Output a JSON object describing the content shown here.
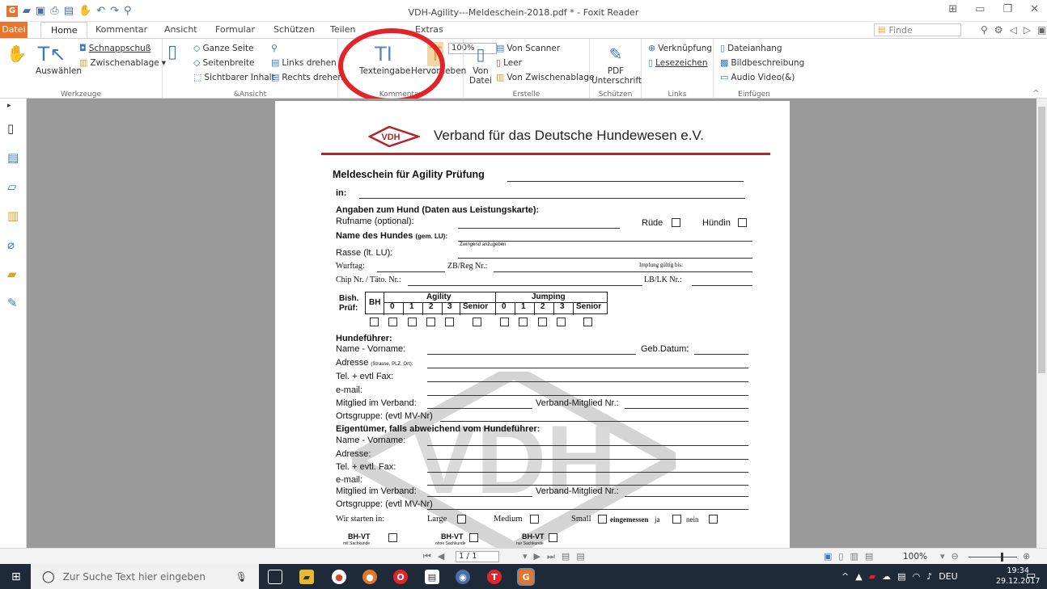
{
  "window": {
    "title": "VDH-Agility---Meldeschein-2018.pdf * - Foxit Reader",
    "app_logo": "G"
  },
  "menubar": {
    "tabs": [
      "Datei",
      "Home",
      "Kommentar",
      "Ansicht",
      "Formular",
      "Schützen",
      "Teilen",
      "Extras"
    ],
    "search_placeholder": "Finde"
  },
  "ribbon": {
    "werkzeuge": {
      "label": "Werkzeuge",
      "auswaehlen": "Auswählen",
      "schnappschuss": "Schnappschuß",
      "zwischenablage": "Zwischenablage"
    },
    "ansicht": {
      "label": "&Ansicht",
      "ganze_seite": "Ganze Seite",
      "seitenbreite": "Seitenbreite",
      "sichtbarer_inhalt": "Sichtbarer Inhalt",
      "zoom": "100%",
      "links_drehen": "Links drehen",
      "rechts_drehen": "Rechts drehen"
    },
    "kommentar": {
      "label": "Kommentar",
      "texteingabe": "Texteingabe",
      "hervorheben": "Hervorheben"
    },
    "erstelle": {
      "label": "Erstelle",
      "von_datei_1": "Von",
      "von_datei_2": "Datei",
      "von_scanner": "Von Scanner",
      "leer": "Leer",
      "von_zwischenablage": "Von Zwischenablage"
    },
    "schuetzen": {
      "label": "Schützen",
      "pdf": "PDF",
      "unterschrift": "Unterschrift"
    },
    "links": {
      "label": "Links",
      "verknuepfung": "Verknüpfung",
      "lesezeichen": "Lesezeichen"
    },
    "einfuegen": {
      "label": "Einfügen",
      "dateianhang": "Dateianhang",
      "bildbeschreibung": "Bildbeschreibung",
      "audio_video": "Audio Video(&)"
    }
  },
  "document": {
    "org_name": "Verband für das Deutsche Hundewesen e.V.",
    "logo_text": "VDH",
    "watermark_text": "VDH",
    "heading": "Meldeschein für Agility Prüfung",
    "in": "in:",
    "dog_section": "Angaben zum Hund (Daten aus Leistungskarte):",
    "rufname": "Rufname (optional):",
    "ruede": "Rüde",
    "huendin": "Hündin",
    "name_hund": "Name des Hundes",
    "gem_lu": "(gem. LU):",
    "zwingend": "Zwingend anzugeben",
    "rasse": "Rasse (lt. LU):",
    "wurftag": "Wurftag:",
    "zbreg": "ZB/Reg Nr.:",
    "impfung": "Impfung gültig bis:",
    "chip": "Chip Nr. / Täto. Nr.:",
    "lblk": "LB/LK Nr.:",
    "bish": "Bish.",
    "pruef": "Prüf:",
    "bh": "BH",
    "agility": "Agility",
    "jumping": "Jumping",
    "classes": [
      "0",
      "1",
      "2",
      "3",
      "Senior"
    ],
    "hundefuehrer": "Hundeführer:",
    "name_vorname": "Name - Vorname:",
    "geb_datum": "Geb.Datum:",
    "adresse": "Adresse",
    "adresse_small": "(Strasse, PLZ, Ort):",
    "tel_fax": "Tel. + evtl Fax:",
    "email": "e-mail:",
    "mitglied": "Mitglied im Verband:",
    "verband_mitglied": "Verband-Mitglied Nr.:",
    "ortsgruppe": "Ortsgruppe: (evtl MV-Nr)",
    "eigentuemer": "Eigentümer, falls abweichend vom Hundeführer:",
    "adresse2": "Adresse:",
    "tel_fax2": "Tel. + evtl. Fax:",
    "wir_starten": "Wir starten in:",
    "large": "Large",
    "medium": "Medium",
    "small": "Small",
    "eingemessen": "eingemessen",
    "ja": "ja",
    "nein": "nein",
    "bhvt": "BH-VT",
    "mit_sachkunde": "mit Sachkunde",
    "ohne_sachkunde": "ohne Sachkunde",
    "nur_sachkunde": "nur Sachkunde"
  },
  "statusbar": {
    "page": "1 / 1",
    "zoom": "100%"
  },
  "taskbar": {
    "search_placeholder": "Zur Suche Text hier eingeben",
    "language": "DEU",
    "time": "19:34",
    "date": "29.12.2017"
  },
  "colors": {
    "accent": "#e8732a",
    "ribbon_icon": "#3a78c4",
    "highlight": "#e2242a",
    "doc_red": "#b2262b"
  }
}
